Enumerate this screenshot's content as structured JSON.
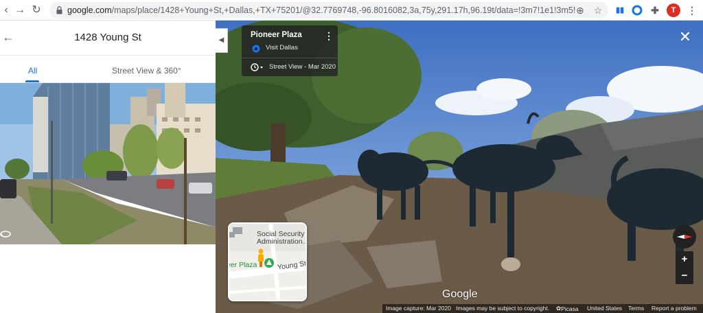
{
  "browser": {
    "url_host": "google.com",
    "url_rest": "/maps/place/1428+Young+St,+Dallas,+TX+75201/@32.7769748,-96.8016082,3a,75y,291.17h,96.19t/data=!3m7!1e1!3m5!1sAF1Qip...",
    "profile_initial": "T",
    "colors": {
      "profile": "#d93025",
      "ext_blue": "#1a73e8"
    }
  },
  "left_panel": {
    "title": "1428 Young St",
    "tabs": [
      {
        "label": "All",
        "active": true
      },
      {
        "label": "Street View & 360°",
        "active": false
      }
    ]
  },
  "street_view": {
    "place_name": "Pioneer Plaza",
    "source": "Visit Dallas",
    "capture_menu": "Street View - Mar 2020",
    "minimap_labels": {
      "poi": "Social Security Administration...",
      "plaza": "eer Plaza",
      "street": "Young St"
    },
    "logo": "Google",
    "footer": {
      "capture": "Image capture: Mar 2020",
      "copyright": "Images may be subject to copyright.",
      "provider": "Picasa",
      "country": "United States",
      "terms": "Terms",
      "report": "Report a problem"
    }
  }
}
